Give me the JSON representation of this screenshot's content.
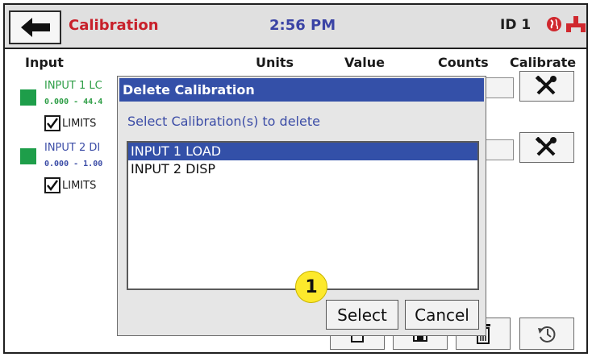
{
  "header": {
    "title": "Calibration",
    "time": "2:56 PM",
    "device_id": "ID 1",
    "back_icon": "arrow-left-icon",
    "globe_icon": "globe-icon",
    "network_icon": "network-icon",
    "colors": {
      "title": "#c8202a",
      "time": "#3a43a5",
      "globe": "#d0282e",
      "network": "#d0282e"
    }
  },
  "table": {
    "headers": {
      "input": "Input",
      "units": "Units",
      "value": "Value",
      "counts": "Counts",
      "calibrate": "Calibrate"
    },
    "rows": [
      {
        "name": "INPUT 1 LC",
        "range": "0.000 - 44.4",
        "limits_label": "LIMITS",
        "limits_checked": true,
        "name_color": "#2e9e46",
        "range_color": "#2e9e46",
        "calibrate_icon": "wrench-screwdriver-icon"
      },
      {
        "name": "INPUT 2 DI",
        "range": "0.000 - 1.00",
        "limits_label": "LIMITS",
        "limits_checked": true,
        "name_color": "#3b4ca6",
        "range_color": "#3b4ca6",
        "calibrate_icon": "wrench-screwdriver-icon"
      }
    ]
  },
  "bottom_bar": {
    "icons": [
      "copy-icon",
      "save-icon",
      "delete-icon",
      "restore-icon"
    ]
  },
  "dialog": {
    "title": "Delete Calibration",
    "prompt": "Select Calibration(s) to delete",
    "items": [
      {
        "label": "INPUT 1 LOAD",
        "selected": true
      },
      {
        "label": "INPUT 2 DISP",
        "selected": false
      }
    ],
    "select_label": "Select",
    "cancel_label": "Cancel"
  },
  "annotation": {
    "marker": "1"
  }
}
